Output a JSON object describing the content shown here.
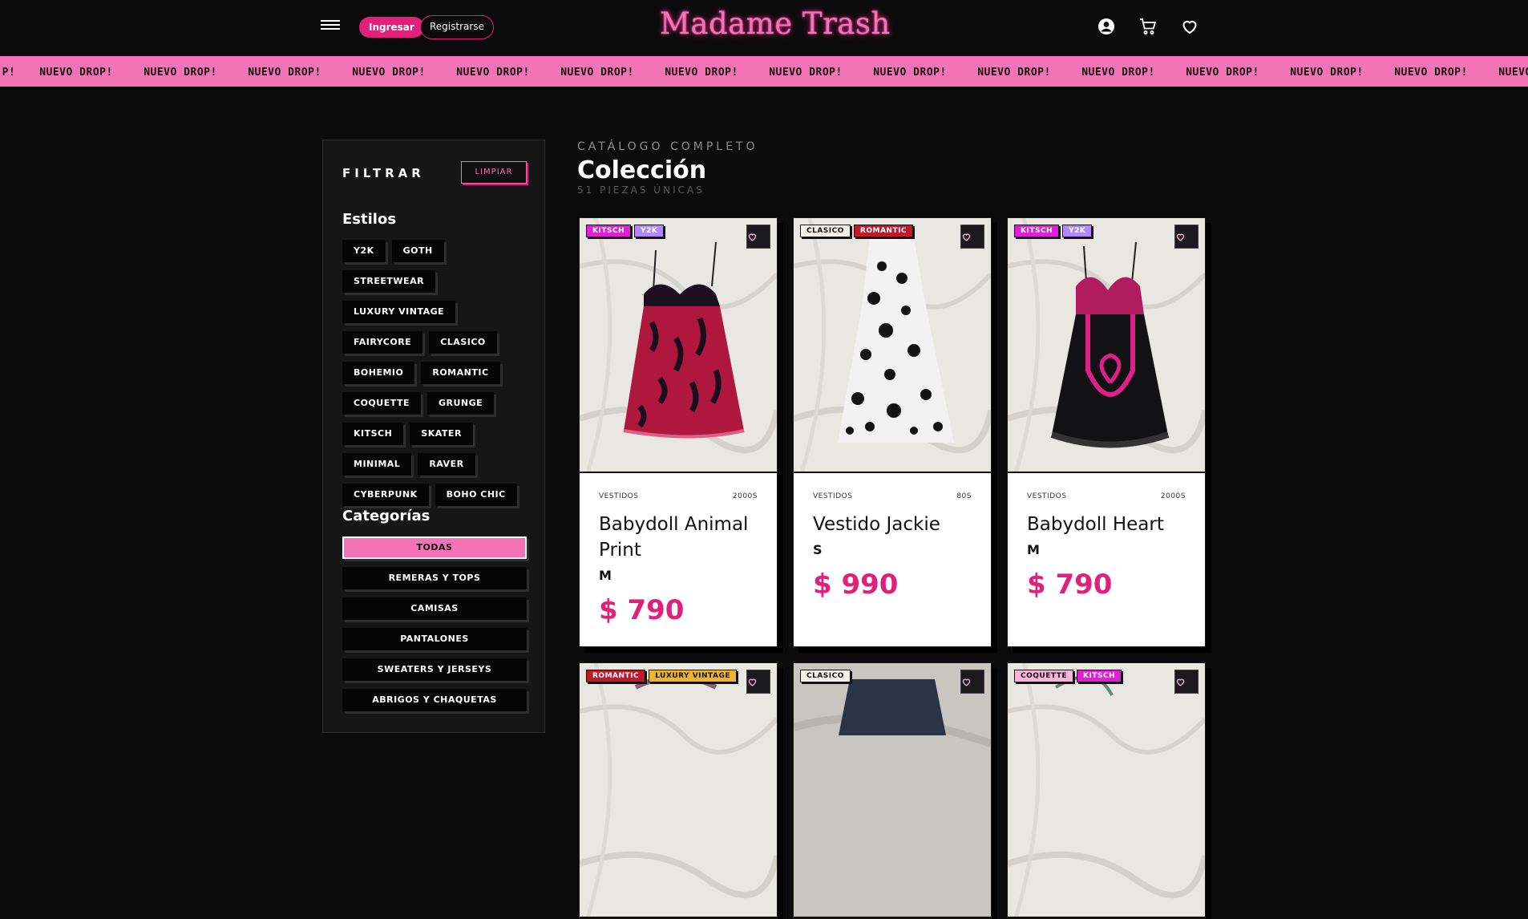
{
  "header": {
    "login_label": "Ingresar",
    "register_label": "Registrarse",
    "logo_text": "Madame Trash",
    "icons": [
      "user-circle-icon",
      "cart-icon",
      "heart-icon"
    ]
  },
  "ticker": {
    "text": "NUEVO DROP!",
    "edge_fragment": "P!",
    "accent": "#f472b6"
  },
  "sidebar": {
    "filter_title": "FILTRAR",
    "clear_label": "LIMPIAR",
    "styles_title": "Estilos",
    "styles": [
      "Y2K",
      "GOTH",
      "STREETWEAR",
      "LUXURY VINTAGE",
      "FAIRYCORE",
      "CLASICO",
      "BOHEMIO",
      "ROMANTIC",
      "COQUETTE",
      "GRUNGE",
      "KITSCH",
      "SKATER",
      "MINIMAL",
      "RAVER",
      "CYBERPUNK",
      "BOHO CHIC"
    ],
    "categories_title": "Categorías",
    "categories": [
      "TODAS",
      "REMERAS Y TOPS",
      "CAMISAS",
      "PANTALONES",
      "SWEATERS Y JERSEYS",
      "ABRIGOS Y CHAQUETAS"
    ],
    "active_category": "TODAS"
  },
  "main": {
    "kicker": "CATÁLOGO COMPLETO",
    "title": "Colección",
    "count": "51 PIEZAS ÚNICAS"
  },
  "products": [
    {
      "tags": [
        {
          "label": "KITSCH",
          "bg": "#e11fd6",
          "fg": "#ffffff"
        },
        {
          "label": "Y2K",
          "bg": "#b388ff",
          "fg": "#ffffff"
        }
      ],
      "category": "VESTIDOS",
      "era": "2000S",
      "name": "Babydoll Animal Print",
      "size": "M",
      "price": "$ 790"
    },
    {
      "tags": [
        {
          "label": "CLASICO",
          "bg": "#f5f1e6",
          "fg": "#111111"
        },
        {
          "label": "ROMANTIC",
          "bg": "#c2182b",
          "fg": "#ffffff"
        }
      ],
      "category": "VESTIDOS",
      "era": "80S",
      "name": "Vestido Jackie",
      "size": "S",
      "price": "$ 990"
    },
    {
      "tags": [
        {
          "label": "KITSCH",
          "bg": "#e11fd6",
          "fg": "#ffffff"
        },
        {
          "label": "Y2K",
          "bg": "#b388ff",
          "fg": "#ffffff"
        }
      ],
      "category": "VESTIDOS",
      "era": "2000S",
      "name": "Babydoll Heart",
      "size": "M",
      "price": "$ 790"
    },
    {
      "tags": [
        {
          "label": "ROMANTIC",
          "bg": "#c2182b",
          "fg": "#ffffff"
        },
        {
          "label": "LUXURY VINTAGE",
          "bg": "#f0b429",
          "fg": "#111111"
        }
      ]
    },
    {
      "tags": [
        {
          "label": "CLASICO",
          "bg": "#f5f1e6",
          "fg": "#111111"
        }
      ]
    },
    {
      "tags": [
        {
          "label": "COQUETTE",
          "bg": "#f9b4d8",
          "fg": "#111111"
        },
        {
          "label": "KITSCH",
          "bg": "#e11fd6",
          "fg": "#ffffff"
        }
      ]
    }
  ],
  "colors": {
    "accent": "#e0207a",
    "pink": "#f472b6",
    "bg": "#0b0b0c"
  }
}
